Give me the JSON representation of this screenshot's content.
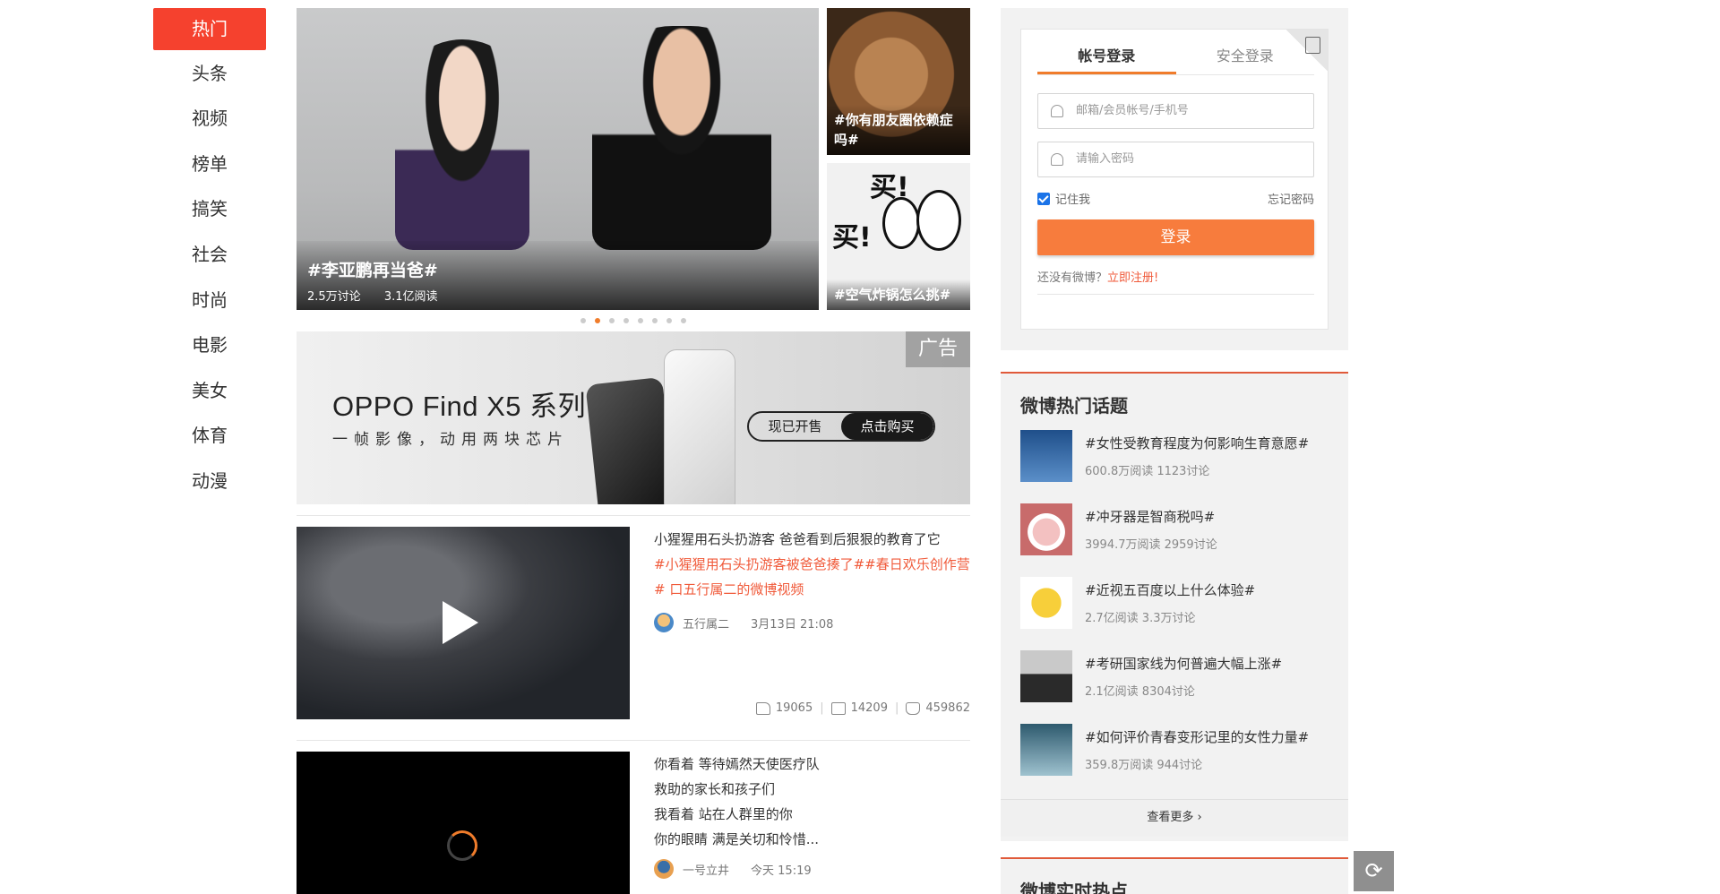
{
  "nav": {
    "items": [
      "热门",
      "头条",
      "视频",
      "榜单",
      "搞笑",
      "社会",
      "时尚",
      "电影",
      "美女",
      "体育",
      "动漫"
    ]
  },
  "carousel": {
    "main": {
      "title": "#李亚鹏再当爸#",
      "discuss": "2.5万讨论",
      "read": "3.1亿阅读"
    },
    "side1": {
      "title": "#你有朋友圈依赖症吗#"
    },
    "side2": {
      "title": "#空气炸锅怎么挑#",
      "buy": "买!"
    },
    "dots": 8,
    "active_dot": 2
  },
  "ad": {
    "brand": "OPPO Find X5 系列",
    "slogan": "一帧影像，动用两块芯片",
    "on_sale": "现已开售",
    "buy": "点击购买",
    "tag": "广告"
  },
  "feed": [
    {
      "title": "小猩猩用石头扔游客 爸爸看到后狠狠的教育了它",
      "tags": "#小猩猩用石头扔游客被爸爸揍了##春日欢乐创作营# 口五行属二的微博视频",
      "author": "五行属二",
      "time": "3月13日 21:08",
      "shares": "19065",
      "comments": "14209",
      "likes": "459862"
    },
    {
      "lines": [
        "你看着 等待嫣然天使医疗队",
        "救助的家长和孩子们",
        "我看着 站在人群里的你",
        "你的眼睛 满是关切和怜惜..."
      ],
      "author": "一号立井",
      "time": "今天 15:19"
    }
  ],
  "login": {
    "tab_account": "帐号登录",
    "tab_secure": "安全登录",
    "user_placeholder": "邮箱/会员帐号/手机号",
    "pass_placeholder": "请输入密码",
    "remember": "记住我",
    "forgot": "忘记密码",
    "submit": "登录",
    "no_account": "还没有微博？",
    "register": "立即注册!"
  },
  "hot": {
    "title": "微博热门话题",
    "topics": [
      {
        "title": "#女性受教育程度为何影响生育意愿#",
        "meta": "600.8万阅读 1123讨论"
      },
      {
        "title": "#冲牙器是智商税吗#",
        "meta": "3994.7万阅读 2959讨论"
      },
      {
        "title": "#近视五百度以上什么体验#",
        "meta": "2.7亿阅读 3.3万讨论"
      },
      {
        "title": "#考研国家线为何普遍大幅上涨#",
        "meta": "2.1亿阅读 8304讨论"
      },
      {
        "title": "#如何评价青春变形记里的女性力量#",
        "meta": "359.8万阅读 944讨论"
      }
    ],
    "more": "查看更多 ›"
  },
  "realtime": {
    "title": "微博实时热点"
  }
}
